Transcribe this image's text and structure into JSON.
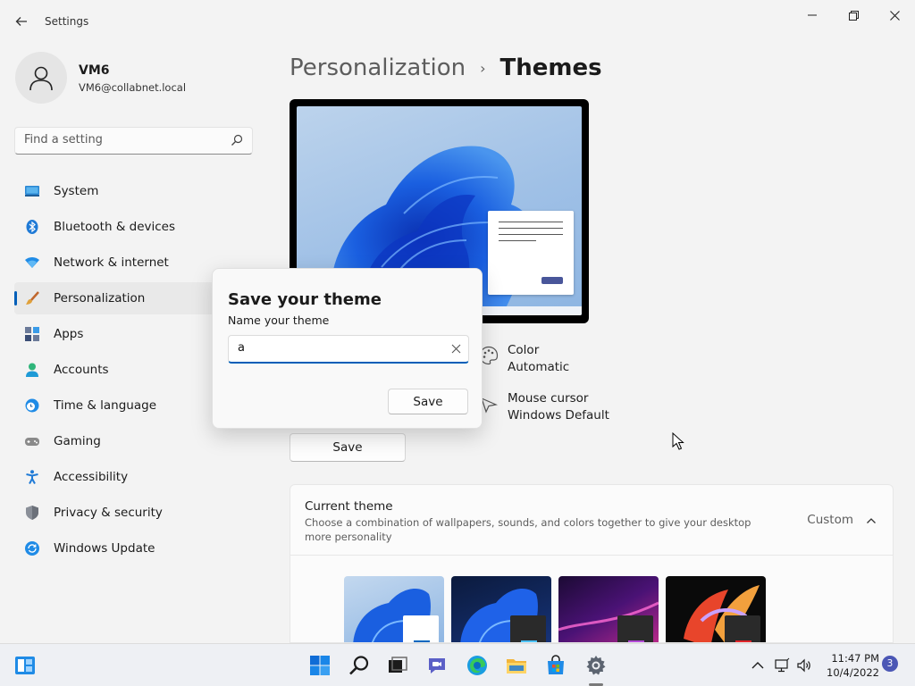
{
  "window": {
    "app_title": "Settings",
    "back_icon": "back-arrow-icon",
    "controls": [
      "minimize-icon",
      "restore-icon",
      "close-icon"
    ]
  },
  "user": {
    "name": "VM6",
    "email": "VM6@collabnet.local"
  },
  "search": {
    "placeholder": "Find a setting"
  },
  "sidebar": {
    "items": [
      {
        "label": "System",
        "icon": "system-icon"
      },
      {
        "label": "Bluetooth & devices",
        "icon": "bluetooth-icon"
      },
      {
        "label": "Network & internet",
        "icon": "wifi-icon"
      },
      {
        "label": "Personalization",
        "icon": "brush-icon",
        "selected": true
      },
      {
        "label": "Apps",
        "icon": "apps-icon"
      },
      {
        "label": "Accounts",
        "icon": "accounts-icon"
      },
      {
        "label": "Time & language",
        "icon": "clock-globe-icon"
      },
      {
        "label": "Gaming",
        "icon": "gamepad-icon"
      },
      {
        "label": "Accessibility",
        "icon": "accessibility-icon"
      },
      {
        "label": "Privacy & security",
        "icon": "shield-icon"
      },
      {
        "label": "Windows Update",
        "icon": "update-icon"
      }
    ]
  },
  "breadcrumb": {
    "parent": "Personalization",
    "separator": "›",
    "current": "Themes"
  },
  "properties": {
    "color": {
      "label": "Color",
      "value": "Automatic",
      "icon": "palette-icon"
    },
    "cursor": {
      "label": "Mouse cursor",
      "value": "Windows Default",
      "icon": "cursor-icon"
    }
  },
  "save_button": "Save",
  "current_theme": {
    "title": "Current theme",
    "description": "Choose a combination of wallpapers, sounds, and colors together to give your desktop more personality",
    "value": "Custom",
    "chevron": "chevron-up-icon"
  },
  "dialog": {
    "title": "Save your theme",
    "subtitle": "Name your theme",
    "input_value": "a",
    "save_label": "Save",
    "clear_icon": "clear-icon"
  },
  "taskbar": {
    "apps": [
      "windows-start-icon",
      "search-icon",
      "task-view-icon",
      "chat-icon",
      "edge-icon",
      "file-explorer-icon",
      "store-icon",
      "settings-icon"
    ],
    "time": "11:47 PM",
    "date": "10/4/2022",
    "notification_count": "3"
  },
  "colors": {
    "accent": "#005fb8",
    "badge": "#4b57b5"
  }
}
